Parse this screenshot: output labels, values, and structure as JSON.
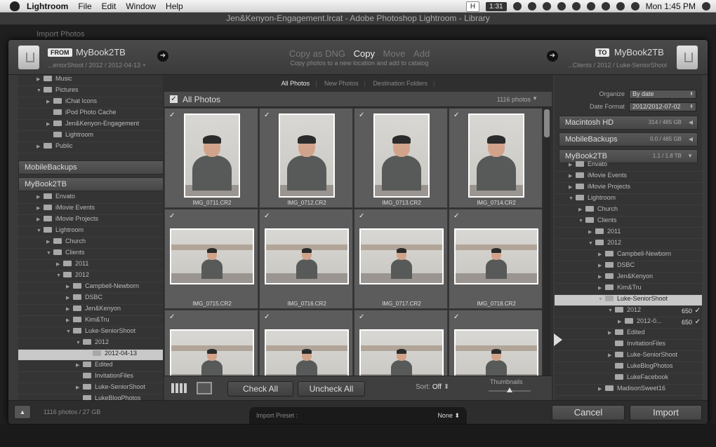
{
  "menubar": {
    "app": "Lightroom",
    "items": [
      "File",
      "Edit",
      "Window",
      "Help"
    ],
    "status_h": "H",
    "status_time_box": "1:31",
    "clock": "Mon 1:45 PM"
  },
  "window": {
    "title": "Jen&Kenyon-Engagement.lrcat - Adobe Photoshop Lightroom - Library",
    "behind_title": "Import Photos"
  },
  "topbar": {
    "from_tag": "FROM",
    "from_volume": "MyBook2TB",
    "from_path": "...eniorShoot / 2012 / 2012-04-13 +",
    "modes": [
      "Copy as DNG",
      "Copy",
      "Move",
      "Add"
    ],
    "active_mode": "Copy",
    "mode_desc": "Copy photos to a new location and add to catalog",
    "to_tag": "TO",
    "to_volume": "MyBook2TB",
    "to_path": "...Clients / 2012 / Luke-SeniorShoot"
  },
  "left_tree": {
    "rows_top": [
      {
        "label": "Music",
        "indent": 1,
        "tri": "▶"
      },
      {
        "label": "Pictures",
        "indent": 1,
        "tri": "▼"
      },
      {
        "label": "iChat Icons",
        "indent": 2,
        "tri": "▶"
      },
      {
        "label": "iPod Photo Cache",
        "indent": 2,
        "tri": ""
      },
      {
        "label": "Jen&Kenyon-Engagement",
        "indent": 2,
        "tri": "▶"
      },
      {
        "label": "Lightroom",
        "indent": 2,
        "tri": ""
      },
      {
        "label": "Public",
        "indent": 1,
        "tri": "▶"
      }
    ],
    "vol1": "MobileBackups",
    "vol2": "MyBook2TB",
    "rows_bottom": [
      {
        "label": "Envato",
        "indent": 1,
        "tri": "▶"
      },
      {
        "label": "iMovie Events",
        "indent": 1,
        "tri": "▶"
      },
      {
        "label": "iMovie Projects",
        "indent": 1,
        "tri": "▶"
      },
      {
        "label": "Lightroom",
        "indent": 1,
        "tri": "▼"
      },
      {
        "label": "Church",
        "indent": 2,
        "tri": "▶"
      },
      {
        "label": "Clients",
        "indent": 2,
        "tri": "▼"
      },
      {
        "label": "2011",
        "indent": 3,
        "tri": "▶"
      },
      {
        "label": "2012",
        "indent": 3,
        "tri": "▼"
      },
      {
        "label": "Campbell-Newborn",
        "indent": 4,
        "tri": "▶"
      },
      {
        "label": "DSBC",
        "indent": 4,
        "tri": "▶"
      },
      {
        "label": "Jen&Kenyon",
        "indent": 4,
        "tri": "▶"
      },
      {
        "label": "Kim&Tru",
        "indent": 4,
        "tri": "▶"
      },
      {
        "label": "Luke-SeniorShoot",
        "indent": 4,
        "tri": "▼"
      },
      {
        "label": "2012",
        "indent": 5,
        "tri": "▼"
      },
      {
        "label": "2012-04-13",
        "indent": 6,
        "tri": "",
        "selected": true
      },
      {
        "label": "Edited",
        "indent": 5,
        "tri": "▶"
      },
      {
        "label": "InvitationFiles",
        "indent": 5,
        "tri": ""
      },
      {
        "label": "Luke-SeniorShoot",
        "indent": 5,
        "tri": "▶"
      },
      {
        "label": "LukeBlogPhotos",
        "indent": 5,
        "tri": ""
      }
    ]
  },
  "center": {
    "tabs": [
      "All Photos",
      "New Photos",
      "Destination Folders"
    ],
    "all_label": "All Photos",
    "count": "1116 photos",
    "photos": [
      {
        "name": "IMG_0711.CR2",
        "orient": "portrait"
      },
      {
        "name": "IMG_0712.CR2",
        "orient": "portrait"
      },
      {
        "name": "IMG_0713.CR2",
        "orient": "portrait"
      },
      {
        "name": "IMG_0714.CR2",
        "orient": "portrait"
      },
      {
        "name": "IMG_0715.CR2",
        "orient": "landscape"
      },
      {
        "name": "IMG_0716.CR2",
        "orient": "landscape"
      },
      {
        "name": "IMG_0717.CR2",
        "orient": "landscape"
      },
      {
        "name": "IMG_0718.CR2",
        "orient": "landscape"
      },
      {
        "name": "",
        "orient": "landscape"
      },
      {
        "name": "",
        "orient": "landscape"
      },
      {
        "name": "",
        "orient": "landscape"
      },
      {
        "name": "",
        "orient": "landscape"
      }
    ],
    "check_all": "Check All",
    "uncheck_all": "Uncheck All",
    "sort_label": "Sort:",
    "sort_value": "Off",
    "thumbnails_label": "Thumbnails"
  },
  "right": {
    "organize_label": "Organize",
    "organize_value": "By date",
    "date_format_label": "Date Format",
    "date_format_value": "2012/2012-07-02",
    "volumes": [
      {
        "name": "Macintosh HD",
        "meta": "314 / 465 GB",
        "tri": "◀"
      },
      {
        "name": "MobileBackups",
        "meta": "0.0 / 465 GB",
        "tri": "◀"
      },
      {
        "name": "MyBook2TB",
        "meta": "1.1 / 1.8 TB",
        "tri": "▼"
      }
    ],
    "rows": [
      {
        "label": "Envato",
        "indent": 1,
        "tri": "▶"
      },
      {
        "label": "iMovie Events",
        "indent": 1,
        "tri": "▶"
      },
      {
        "label": "iMovie Projects",
        "indent": 1,
        "tri": "▶"
      },
      {
        "label": "Lightroom",
        "indent": 1,
        "tri": "▼"
      },
      {
        "label": "Church",
        "indent": 2,
        "tri": "▶"
      },
      {
        "label": "Clients",
        "indent": 2,
        "tri": "▼"
      },
      {
        "label": "2011",
        "indent": 3,
        "tri": "▶"
      },
      {
        "label": "2012",
        "indent": 3,
        "tri": "▼"
      },
      {
        "label": "Campbell-Newborn",
        "indent": 4,
        "tri": "▶"
      },
      {
        "label": "DSBC",
        "indent": 4,
        "tri": "▶"
      },
      {
        "label": "Jen&Kenyon",
        "indent": 4,
        "tri": "▶"
      },
      {
        "label": "Kim&Tru",
        "indent": 4,
        "tri": "▶"
      },
      {
        "label": "Luke-SeniorShoot",
        "indent": 4,
        "tri": "▼",
        "selected": true
      },
      {
        "label": "2012",
        "indent": 5,
        "tri": "▼",
        "count": "650",
        "check": "✓"
      },
      {
        "label": "2012-0...",
        "indent": 6,
        "tri": "▶",
        "count": "650",
        "check": "✓"
      },
      {
        "label": "Edited",
        "indent": 5,
        "tri": "▶"
      },
      {
        "label": "InvitationFiles",
        "indent": 5,
        "tri": ""
      },
      {
        "label": "Luke-SeniorShoot",
        "indent": 5,
        "tri": "▶"
      },
      {
        "label": "LukeBlogPhotos",
        "indent": 5,
        "tri": ""
      },
      {
        "label": "LukeFacebook",
        "indent": 5,
        "tri": ""
      },
      {
        "label": "MadisonSweet16",
        "indent": 4,
        "tri": "▶"
      }
    ]
  },
  "footer": {
    "info": "1116 photos / 27 GB",
    "preset_label": "Import Preset :",
    "preset_value": "None",
    "cancel": "Cancel",
    "import": "Import"
  }
}
